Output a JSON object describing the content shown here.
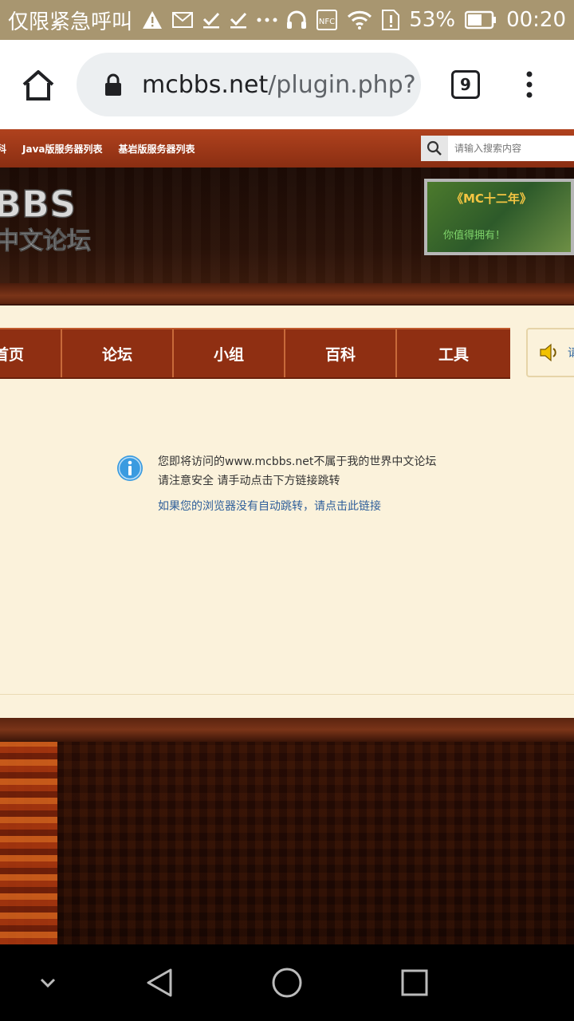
{
  "status_bar": {
    "carrier_text": "仅限紧急呼叫",
    "battery_percent": "53%",
    "time": "00:20",
    "icons": [
      "warning-icon",
      "mail-icon",
      "check-icon",
      "check-icon",
      "more-icon",
      "headphones-icon",
      "nfc-icon",
      "wifi-icon",
      "sim-alert-icon",
      "battery-icon"
    ],
    "nfc_label": "NFC"
  },
  "browser": {
    "url_host": "mcbbs.net",
    "url_path": "/plugin.php?",
    "tab_count": "9"
  },
  "site": {
    "topbar_links": [
      "科",
      "Java版服务器列表",
      "基岩版服务器列表"
    ],
    "search_placeholder": "请输入搜索内容",
    "logo_text_top": "BBS",
    "logo_text_bottom": "中文论坛",
    "ad_text_top": "《MC十二年》",
    "ad_text_bottom": "你值得拥有！",
    "nav_items": [
      {
        "label": "首页"
      },
      {
        "label": "论坛"
      },
      {
        "label": "小组"
      },
      {
        "label": "百科"
      },
      {
        "label": "工具"
      }
    ],
    "announce_text": "请",
    "notice": {
      "line1": "您即将访问的www.mcbbs.net不属于我的世界中文论坛",
      "line2": "请注意安全 请手动点击下方链接跳转",
      "link": "如果您的浏览器没有自动跳转，请点击此链接"
    }
  },
  "colors": {
    "status_bar_bg": "#a89670",
    "nav_bg": "#8f2f12",
    "page_bg": "#fbf2db",
    "link": "#2e5e9a",
    "info_icon": "#3a9be0"
  }
}
